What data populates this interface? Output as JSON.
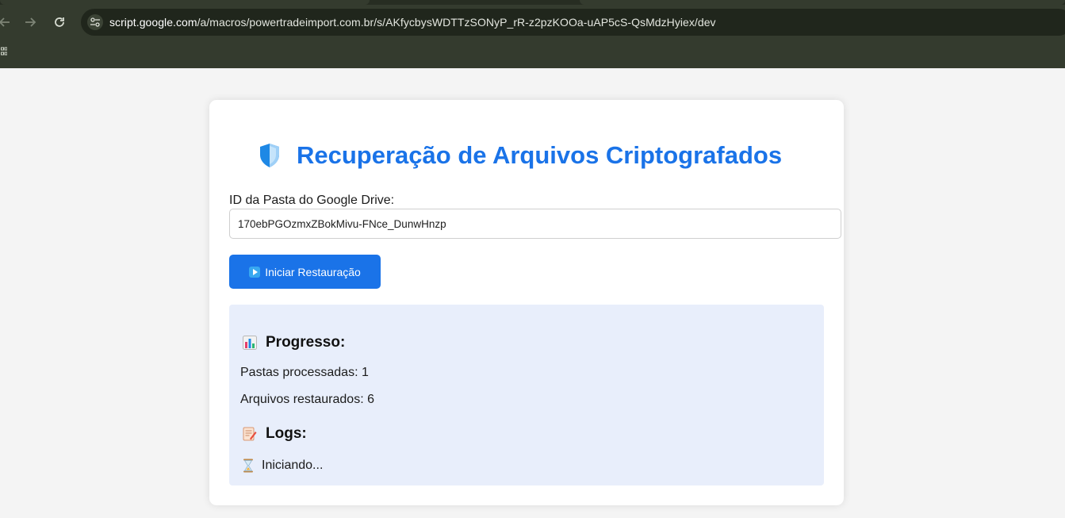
{
  "browser": {
    "url_host": "script.google.com",
    "url_path": "/a/macros/powertradeimport.com.br/s/AKfycbysWDTTzSONyP_rR-z2pzKOOa-uAP5cS-QsMdzHyiex/dev"
  },
  "page": {
    "title": "Recuperação de Arquivos Criptografados",
    "folder_label": "ID da Pasta do Google Drive:",
    "folder_value": "170ebPGOzmxZBokMivu-FNce_DunwHnzp",
    "start_button_label": "Iniciar Restauração"
  },
  "progress": {
    "heading": "Progresso:",
    "folders_line": "Pastas processadas: 1",
    "files_line": "Arquivos restaurados: 6"
  },
  "logs": {
    "heading": "Logs:",
    "entries": [
      "Iniciando..."
    ]
  },
  "icons": {
    "title": "shield-icon",
    "start": "play-icon",
    "progress": "bar-chart-icon",
    "logs": "memo-icon",
    "log_entry": "hourglass-icon"
  },
  "colors": {
    "accent": "#1a73e8",
    "panel": "#e8eefb"
  }
}
